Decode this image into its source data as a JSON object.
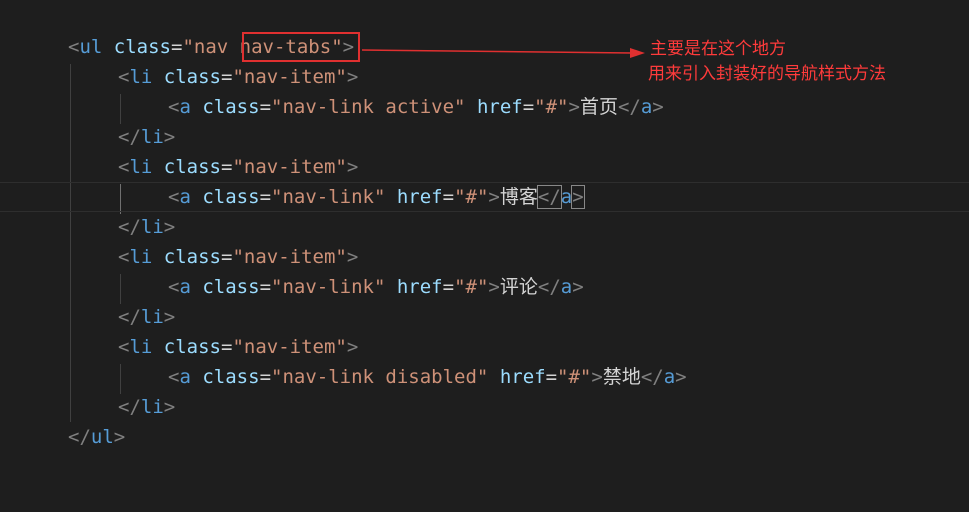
{
  "annotation": {
    "line1": "主要是在这个地方",
    "line2": "用来引入封装好的导航样式方法",
    "color": "#ff3b3b"
  },
  "code": {
    "l1": {
      "open": "<",
      "tag": "ul",
      "attr": "class",
      "eq": "=",
      "q1": "\"",
      "val": "nav nav-tabs",
      "q2": "\"",
      "close": ">"
    },
    "l2": {
      "open": "<",
      "tag": "li",
      "attr": "class",
      "eq": "=",
      "val": "\"nav-item\"",
      "close": ">"
    },
    "l3": {
      "open": "<",
      "tag": "a",
      "attr1": "class",
      "eq1": "=",
      "val1": "\"nav-link active\"",
      "attr2": "href",
      "eq2": "=",
      "val2": "\"#\"",
      "close": ">",
      "text": "首页",
      "end_open": "</",
      "end_tag": "a",
      "end_close": ">"
    },
    "l4": {
      "open": "</",
      "tag": "li",
      "close": ">"
    },
    "l5": {
      "open": "<",
      "tag": "li",
      "attr": "class",
      "eq": "=",
      "val": "\"nav-item\"",
      "close": ">"
    },
    "l6": {
      "open": "<",
      "tag": "a",
      "attr1": "class",
      "eq1": "=",
      "val1": "\"nav-link\"",
      "attr2": "href",
      "eq2": "=",
      "val2": "\"#\"",
      "close": ">",
      "text": "博客",
      "end_open": "</",
      "end_tag": "a",
      "end_close": ">"
    },
    "l7": {
      "open": "</",
      "tag": "li",
      "close": ">"
    },
    "l8": {
      "open": "<",
      "tag": "li",
      "attr": "class",
      "eq": "=",
      "val": "\"nav-item\"",
      "close": ">"
    },
    "l9": {
      "open": "<",
      "tag": "a",
      "attr1": "class",
      "eq1": "=",
      "val1": "\"nav-link\"",
      "attr2": "href",
      "eq2": "=",
      "val2": "\"#\"",
      "close": ">",
      "text": "评论",
      "end_open": "</",
      "end_tag": "a",
      "end_close": ">"
    },
    "l10": {
      "open": "</",
      "tag": "li",
      "close": ">"
    },
    "l11": {
      "open": "<",
      "tag": "li",
      "attr": "class",
      "eq": "=",
      "val": "\"nav-item\"",
      "close": ">"
    },
    "l12": {
      "open": "<",
      "tag": "a",
      "attr1": "class",
      "eq1": "=",
      "val1": "\"nav-link disabled\"",
      "attr2": "href",
      "eq2": "=",
      "val2": "\"#\"",
      "close": ">",
      "text": "禁地",
      "end_open": "</",
      "end_tag": "a",
      "end_close": ">"
    },
    "l13": {
      "open": "</",
      "tag": "li",
      "close": ">"
    },
    "l14": {
      "open": "</",
      "tag": "ul",
      "close": ">"
    }
  }
}
